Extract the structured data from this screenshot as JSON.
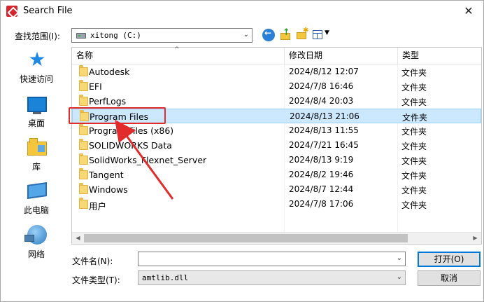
{
  "window": {
    "title": "Search File",
    "close_glyph": "✕"
  },
  "lookin": {
    "label": "查找范围(I):",
    "value": "xitong (C:)"
  },
  "toolbar": {
    "back_icon": "back-arrow-icon",
    "up_icon": "up-folder-icon",
    "new_folder_icon": "new-folder-icon",
    "view_icon": "view-menu-icon"
  },
  "places": [
    {
      "label": "快速访问",
      "icon": "quick-access-star-icon"
    },
    {
      "label": "桌面",
      "icon": "desktop-icon"
    },
    {
      "label": "库",
      "icon": "library-icon"
    },
    {
      "label": "此电脑",
      "icon": "this-pc-icon"
    },
    {
      "label": "网络",
      "icon": "network-icon"
    }
  ],
  "columns": {
    "name": "名称",
    "date": "修改日期",
    "type": "类型"
  },
  "files": [
    {
      "name": "Autodesk",
      "date": "2024/8/12 12:07",
      "type": "文件夹"
    },
    {
      "name": "EFI",
      "date": "2024/7/8 16:46",
      "type": "文件夹"
    },
    {
      "name": "PerfLogs",
      "date": "2024/8/4 20:03",
      "type": "文件夹"
    },
    {
      "name": "Program Files",
      "date": "2024/8/13 21:06",
      "type": "文件夹"
    },
    {
      "name": "Program Files (x86)",
      "date": "2024/8/13 11:55",
      "type": "文件夹"
    },
    {
      "name": "SOLIDWORKS Data",
      "date": "2024/7/21 16:45",
      "type": "文件夹"
    },
    {
      "name": "SolidWorks_Flexnet_Server",
      "date": "2024/8/13 9:19",
      "type": "文件夹"
    },
    {
      "name": "Tangent",
      "date": "2024/8/2 19:46",
      "type": "文件夹"
    },
    {
      "name": "Windows",
      "date": "2024/8/7 12:44",
      "type": "文件夹"
    },
    {
      "name": "用户",
      "date": "2024/7/8 17:06",
      "type": "文件夹"
    }
  ],
  "selected_file": "Program Files",
  "filename": {
    "label": "文件名(N):",
    "value": ""
  },
  "filetype": {
    "label": "文件类型(T):",
    "value": "amtlib.dll"
  },
  "buttons": {
    "open": "打开(O)",
    "cancel": "取消"
  },
  "colors": {
    "selection": "#cce8ff",
    "annotation": "#e22b2b",
    "accent": "#0078d7"
  }
}
